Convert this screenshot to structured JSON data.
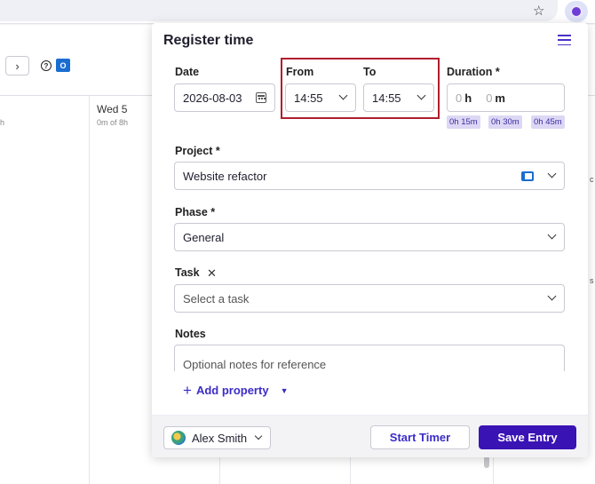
{
  "browser": {
    "star_icon": "star-icon",
    "extension_icon": "extension-icon"
  },
  "background": {
    "day_label": "Wed 5",
    "day_sub_prefix": "0m",
    "day_sub_suffix": "of 8h",
    "left_sub": "h",
    "right_frag_1": "c",
    "right_frag_2": "s"
  },
  "panel": {
    "title": "Register time",
    "date": {
      "label": "Date",
      "value": "2026-08-03"
    },
    "from": {
      "label": "From",
      "value": "14:55"
    },
    "to": {
      "label": "To",
      "value": "14:55"
    },
    "duration": {
      "label": "Duration *",
      "hours": "0",
      "hours_unit": "h",
      "minutes": "0",
      "minutes_unit": "m"
    },
    "quick_durations": [
      "0h 15m",
      "0h 30m",
      "0h 45m"
    ],
    "project": {
      "label": "Project *",
      "value": "Website refactor"
    },
    "phase": {
      "label": "Phase *",
      "value": "General"
    },
    "task": {
      "label": "Task",
      "placeholder": "Select a task"
    },
    "notes": {
      "label": "Notes",
      "placeholder": "Optional notes for reference"
    },
    "add_property": "Add property",
    "footer": {
      "user": "Alex Smith",
      "start_timer": "Start Timer",
      "save_entry": "Save Entry"
    }
  },
  "colors": {
    "accent": "#3a13b5",
    "highlight": "#b01e2e",
    "chip_bg": "#ddd7f5"
  }
}
